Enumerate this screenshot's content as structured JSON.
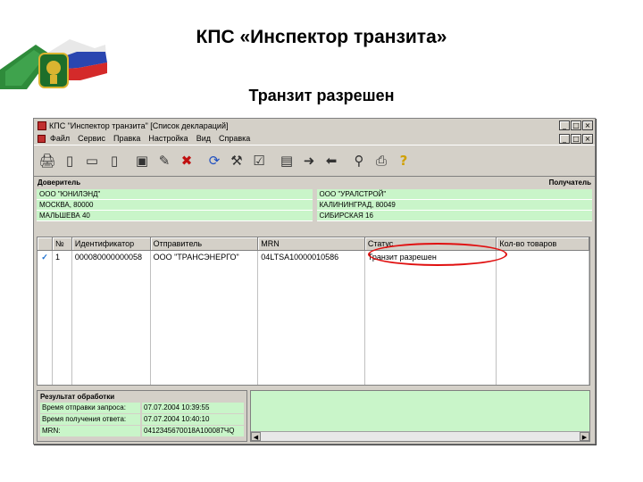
{
  "slide": {
    "title": "КПС «Инспектор транзита»",
    "subtitle": "Транзит разрешен"
  },
  "window": {
    "title": "КПС \"Инспектор транзита\" [Список деклараций]",
    "controls": [
      "_",
      "□",
      "×"
    ],
    "menu": [
      "Файл",
      "Сервис",
      "Правка",
      "Настройка",
      "Вид",
      "Справка"
    ],
    "toolbar_icons": [
      "print-icon",
      "new-doc-icon",
      "open-folder-icon",
      "doc-icon",
      "save-icon",
      "edit-icon",
      "delete-icon",
      "refresh-icon",
      "tools-icon",
      "check-list-icon",
      "book-icon",
      "forward-icon",
      "back-icon",
      "search-icon",
      "printer-icon",
      "help-icon"
    ]
  },
  "parties": {
    "left_label": "Доверитель",
    "right_label": "Получатель",
    "left_rows": [
      "ООО \"ЮНИЛЭНД\"",
      "МОСКВА, 80000",
      "МАЛЬШЕВА 40"
    ],
    "right_rows": [
      "ООО \"УРАЛСТРОЙ\"",
      "КАЛИНИНГРАД, 80049",
      "СИБИРСКАЯ 16"
    ]
  },
  "table": {
    "columns": [
      "№",
      "Идентификатор",
      "Отправитель",
      "MRN",
      "Статус",
      "Кол-во товаров"
    ],
    "rows": [
      {
        "check": "✓",
        "num": "1",
        "id": "000080000000058",
        "sender": "ООО \"ТРАНСЭНЕРГО\"",
        "mrn": "04LTSA10000010586",
        "status": "Транзит разрешен",
        "qty": ""
      }
    ]
  },
  "result": {
    "title": "Результат обработки",
    "rows": [
      {
        "label": "Время отправки запроса:",
        "value": "07.07.2004 10:39:55"
      },
      {
        "label": "Время получения ответа:",
        "value": "07.07.2004 10:40:10"
      },
      {
        "label": "MRN:",
        "value": "0412345670018А100087ЧQ"
      }
    ]
  },
  "colors": {
    "highlight": "#e01010",
    "panel_green": "#c9f5c9"
  }
}
